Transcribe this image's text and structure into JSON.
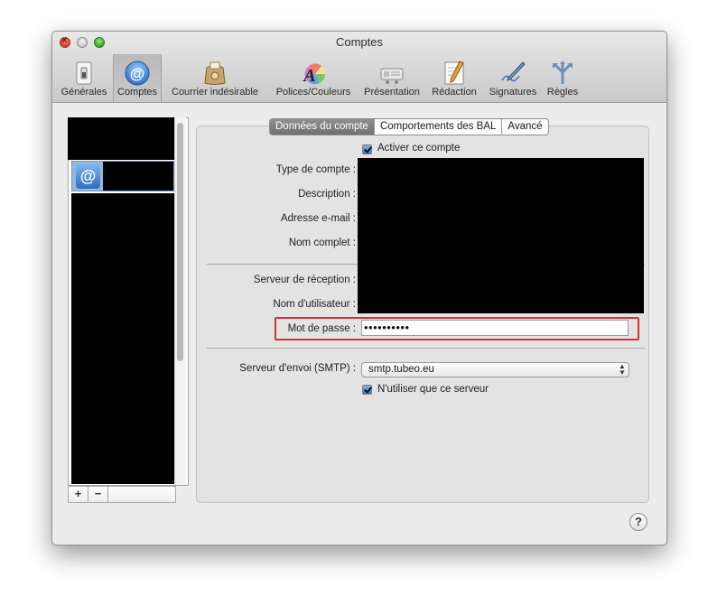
{
  "window": {
    "title": "Comptes"
  },
  "toolbar": {
    "items": [
      {
        "label": "Générales",
        "icon": "light-switch-icon"
      },
      {
        "label": "Comptes",
        "icon": "at-sign-icon",
        "selected": true
      },
      {
        "label": "Courrier indésirable",
        "icon": "junk-mail-bag-icon"
      },
      {
        "label": "Polices/Couleurs",
        "icon": "fonts-colors-icon"
      },
      {
        "label": "Présentation",
        "icon": "view-icon"
      },
      {
        "label": "Rédaction",
        "icon": "compose-pencil-icon"
      },
      {
        "label": "Signatures",
        "icon": "signature-pen-icon"
      },
      {
        "label": "Règles",
        "icon": "rules-arrows-icon"
      }
    ]
  },
  "accounts": {
    "add_label": "+",
    "remove_label": "−"
  },
  "tabs": [
    {
      "label": "Données du compte",
      "active": true
    },
    {
      "label": "Comportements des BAL",
      "active": false
    },
    {
      "label": "Avancé",
      "active": false
    }
  ],
  "form": {
    "enable_account": {
      "label": "Activer ce compte",
      "checked": true
    },
    "account_type_label": "Type de compte :",
    "description_label": "Description :",
    "email_label": "Adresse e-mail :",
    "full_name_label": "Nom complet :",
    "incoming_server_label": "Serveur de réception :",
    "username_label": "Nom d'utilisateur :",
    "password_label": "Mot de passe :",
    "password_value": "••••••••••",
    "smtp_label": "Serveur d'envoi (SMTP) :",
    "smtp_value": "smtp.tubeo.eu",
    "only_this_server": {
      "label": "N'utiliser que ce serveur",
      "checked": true
    }
  },
  "help": {
    "label": "?"
  },
  "colors": {
    "highlight": "#d43232",
    "selection": "#96b7dd",
    "active_tab": "#7d7d7d"
  }
}
